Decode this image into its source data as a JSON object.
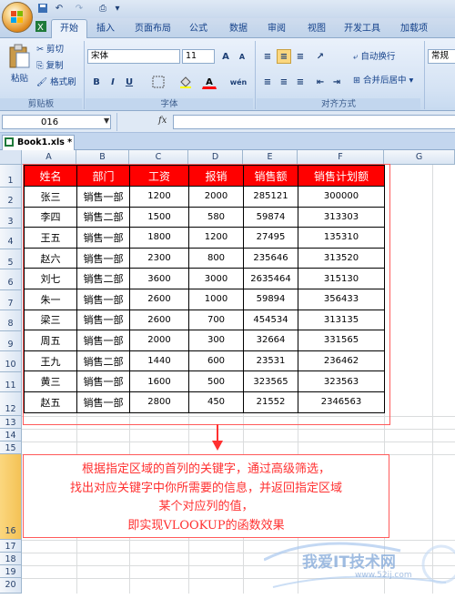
{
  "quick_access": [
    "save-icon",
    "undo-icon",
    "redo-icon",
    "print-preview-icon"
  ],
  "tabs": [
    "开始",
    "插入",
    "页面布局",
    "公式",
    "数据",
    "审阅",
    "视图",
    "开发工具",
    "加载项"
  ],
  "ribbon": {
    "clipboard": {
      "paste": "粘贴",
      "cut": "剪切",
      "copy": "复制",
      "format_painter": "格式刷",
      "label": "剪贴板"
    },
    "font": {
      "name": "宋体",
      "size": "11",
      "bold": "B",
      "italic": "I",
      "underline": "U",
      "font_color": "A",
      "grow": "A",
      "shrink": "A",
      "phonetic": "wén",
      "label": "字体"
    },
    "alignment": {
      "wrap": "自动换行",
      "merge": "合并后居中",
      "label": "对齐方式"
    },
    "number": {
      "format": "常规"
    }
  },
  "formula_bar": {
    "name_box": "016",
    "fx": "fx"
  },
  "workbook_tab": "Book1.xls *",
  "columns": [
    "A",
    "B",
    "C",
    "D",
    "E",
    "F",
    "G"
  ],
  "rows": [
    "1",
    "2",
    "3",
    "4",
    "5",
    "6",
    "7",
    "8",
    "9",
    "10",
    "11",
    "12",
    "13",
    "14",
    "15",
    "16",
    "17",
    "18",
    "19",
    "20"
  ],
  "table": {
    "headers": [
      "姓名",
      "部门",
      "工资",
      "报销",
      "销售额",
      "销售计划额"
    ],
    "rows": [
      [
        "张三",
        "销售一部",
        "1200",
        "2000",
        "285121",
        "300000"
      ],
      [
        "李四",
        "销售二部",
        "1500",
        "580",
        "59874",
        "313303"
      ],
      [
        "王五",
        "销售一部",
        "1800",
        "1200",
        "27495",
        "135310"
      ],
      [
        "赵六",
        "销售一部",
        "2300",
        "800",
        "235646",
        "313520"
      ],
      [
        "刘七",
        "销售二部",
        "3600",
        "3000",
        "2635464",
        "315130"
      ],
      [
        "朱一",
        "销售一部",
        "2600",
        "1000",
        "59894",
        "356433"
      ],
      [
        "梁三",
        "销售一部",
        "2600",
        "700",
        "454534",
        "313135"
      ],
      [
        "周五",
        "销售一部",
        "2000",
        "300",
        "32664",
        "331565"
      ],
      [
        "王九",
        "销售二部",
        "1440",
        "600",
        "23531",
        "236462"
      ],
      [
        "黄三",
        "销售一部",
        "1600",
        "500",
        "323565",
        "323563"
      ],
      [
        "赵五",
        "销售一部",
        "2800",
        "450",
        "21552",
        "2346563"
      ]
    ]
  },
  "note": [
    "根据指定区域的首列的关键字，通过高级筛选，",
    "找出对应关键字中你所需要的信息，并返回指定区域",
    "某个对应列的值，",
    "即实现VLOOKUP的函数效果"
  ],
  "watermark": {
    "text": "我爱IT技术网",
    "url": "www.52ij.com"
  },
  "colors": {
    "header_fill": "#ff0000",
    "note_text": "#ff3030",
    "ribbon": "#d5e3f4"
  }
}
